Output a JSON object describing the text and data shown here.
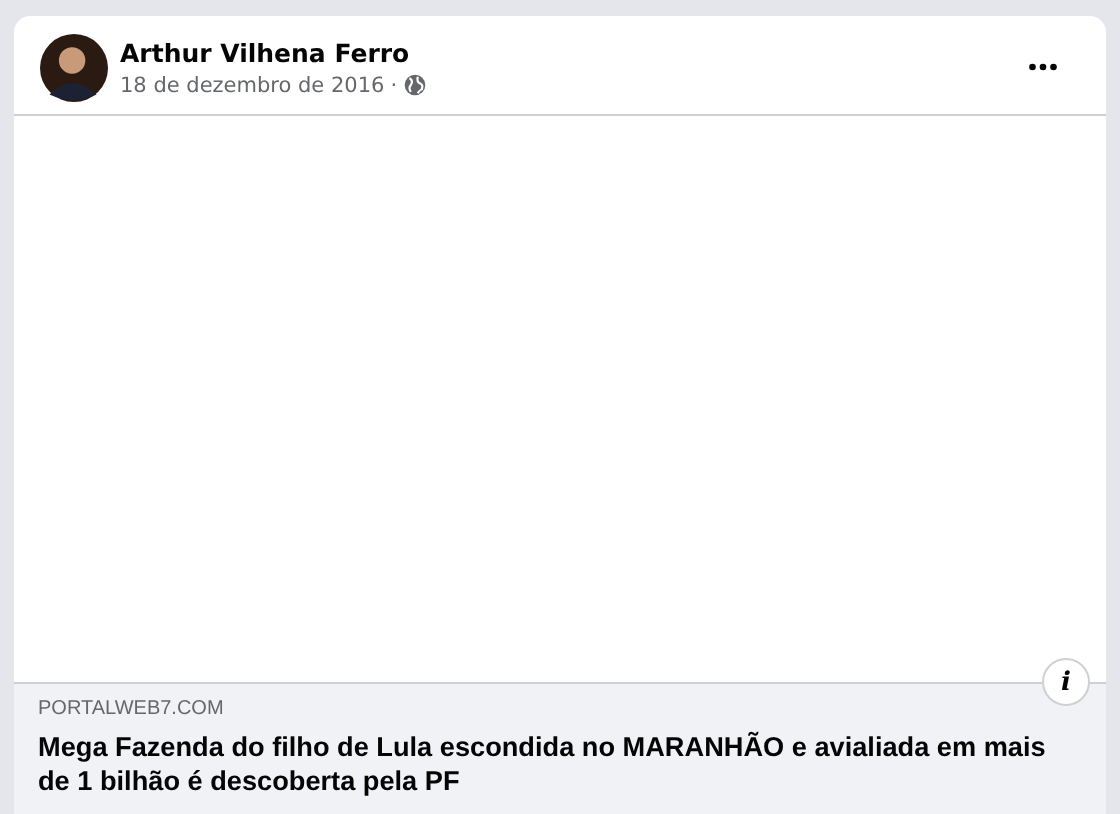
{
  "post": {
    "author": "Arthur Vilhena Ferro",
    "date": "18 de dezembro de 2016",
    "separator": "·",
    "public": true
  },
  "link_preview": {
    "kind": "blank",
    "info": "i",
    "domain": "PORTALWEB7.COM",
    "headline": "Mega Fazenda do filho de Lula escondida no MARANHÃO e avialiada em mais de 1 bilhão é descoberta pela PF"
  }
}
